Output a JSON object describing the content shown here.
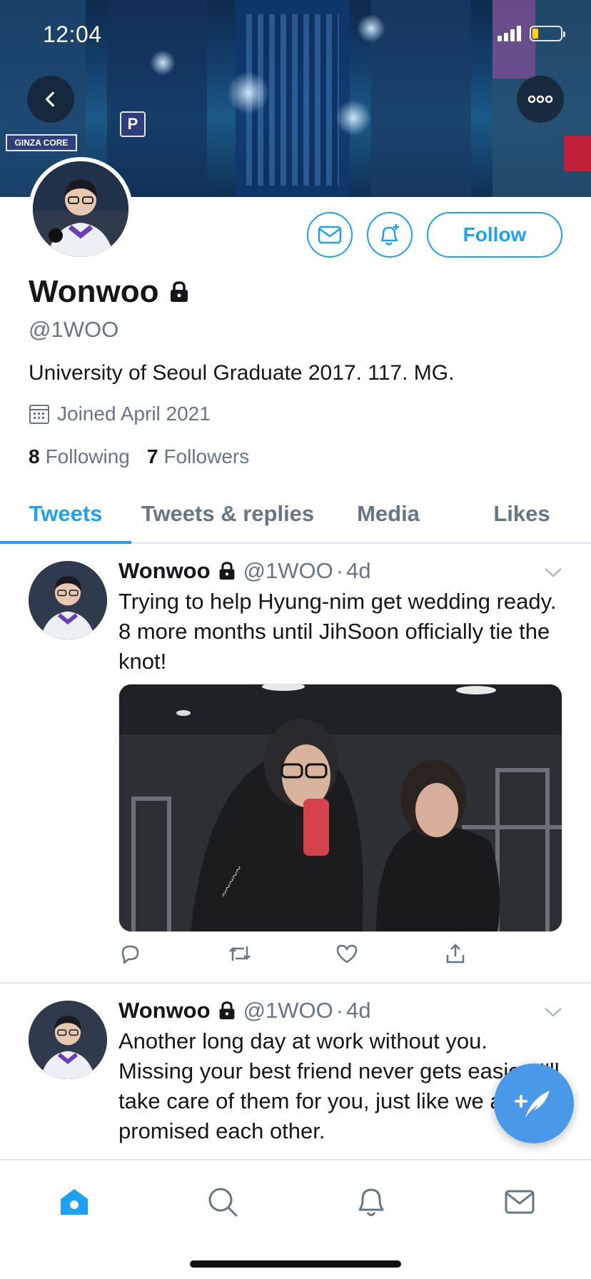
{
  "status_bar": {
    "time": "12:04"
  },
  "profile": {
    "name": "Wonwoo",
    "handle": "@1WOO",
    "bio": "University of Seoul Graduate 2017. 117. MG.",
    "joined": "Joined April 2021",
    "following_count": "8",
    "following_label": "Following",
    "followers_count": "7",
    "followers_label": "Followers",
    "follow_label": "Follow",
    "protected": true
  },
  "tabs": [
    {
      "label": "Tweets",
      "active": true
    },
    {
      "label": "Tweets & replies",
      "active": false
    },
    {
      "label": "Media",
      "active": false
    },
    {
      "label": "Likes",
      "active": false
    }
  ],
  "tweets": [
    {
      "name": "Wonwoo",
      "handle": "@1WOO",
      "separator": "·",
      "time": "4d",
      "text": "Trying to help Hyung-nim get wedding ready. 8 more months until JihSoon officially tie the knot!",
      "has_image": true
    },
    {
      "name": "Wonwoo",
      "handle": "@1WOO",
      "separator": "·",
      "time": "4d",
      "text": "Another long day at work without you. Missing your best friend never gets easier. I'll take care of them for you, just like we always promised each other.",
      "has_image": false
    }
  ],
  "banner_signs": {
    "ginza": "GINZA CORE",
    "parking": "P"
  },
  "colors": {
    "accent": "#1da1f2",
    "fab": "#4a99e9",
    "text": "#14171a",
    "muted": "#657786",
    "battery": "#ffd60a"
  },
  "icons": [
    "back-icon",
    "more-icon",
    "mail-icon",
    "bell-plus-icon",
    "lock-icon",
    "calendar-icon",
    "reply-icon",
    "retweet-icon",
    "like-icon",
    "share-icon",
    "compose-icon",
    "home-icon",
    "search-icon",
    "notifications-icon",
    "messages-icon",
    "chevron-down-icon"
  ]
}
